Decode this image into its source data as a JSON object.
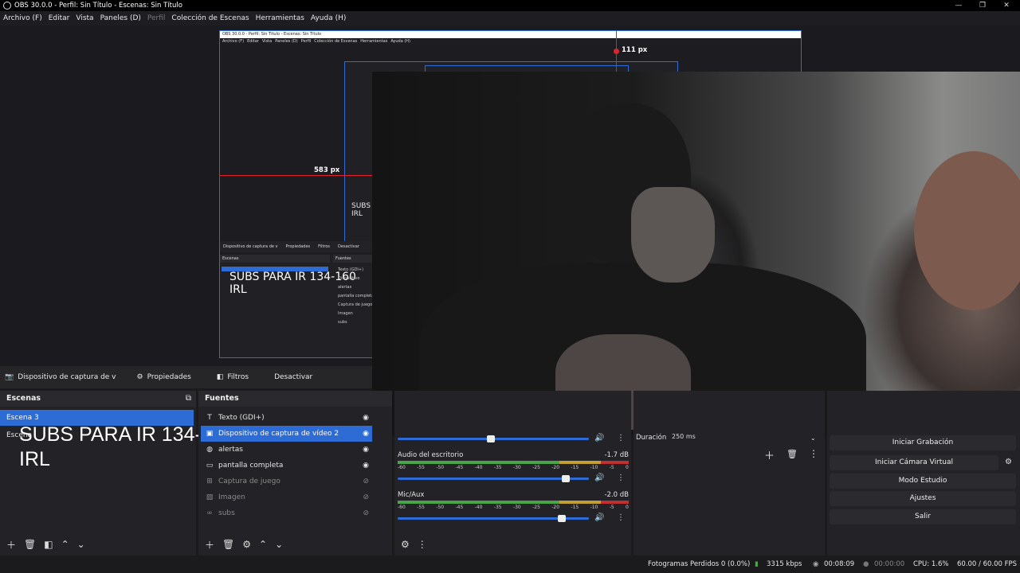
{
  "window": {
    "title": "OBS 30.0.0 - Perfil: Sin Título - Escenas: Sin Título",
    "controls": [
      "minimize",
      "maximize",
      "close"
    ]
  },
  "menu": {
    "items": [
      "Archivo (F)",
      "Editar",
      "Vista",
      "Paneles (D)",
      "Perfil",
      "Colección de Escenas",
      "Herramientas",
      "Ayuda (H)"
    ]
  },
  "preview": {
    "nested_title": "OBS 30.0.0 - Perfil: Sin Título - Escenas: Sin Título",
    "nested_menu": [
      "Archivo (F)",
      "Editar",
      "Vista",
      "Paneles (D)",
      "Perfil",
      "Colección de Escenas",
      "Herramientas",
      "Ayuda (H)"
    ],
    "label_111": "111 px",
    "label_583": "583 px",
    "nested_sourcebar": [
      "Dispositivo de captura de v",
      "Propiedades",
      "Filtros",
      "Desactivar"
    ],
    "nested_scenes_header": "Escenas",
    "nested_sources_header": "Fuentes",
    "nested_scene_sel": "Escena 3",
    "nested_subs": "SUBS PARA IR 134-160\nIRL",
    "nested_subs_small": "SUBS I\nIRL",
    "nested_sources": [
      "Texto (GDI+)",
      "Dispositivo",
      "alertas",
      "pantalla completa",
      "Captura de juego",
      "Imagen",
      "subs"
    ]
  },
  "sourcebar": {
    "source_name": "Dispositivo de captura de v",
    "properties": "Propiedades",
    "filters": "Filtros",
    "deactivate": "Desactivar"
  },
  "scenes": {
    "header": "Escenas",
    "items": [
      "Escena 3",
      "Escena"
    ],
    "selected": "Escena 3"
  },
  "subs_overlay": {
    "line1": "SUBS PARA IR 134-160",
    "line2": "IRL"
  },
  "sources": {
    "header": "Fuentes",
    "items": [
      {
        "name": "Texto (GDI+)",
        "icon": "text-icon",
        "visible": true
      },
      {
        "name": "Dispositivo de captura de vídeo 2",
        "icon": "camera-icon",
        "visible": true
      },
      {
        "name": "alertas",
        "icon": "globe-icon",
        "visible": true
      },
      {
        "name": "pantalla completa",
        "icon": "monitor-icon",
        "visible": true
      },
      {
        "name": "Captura de juego",
        "icon": "gamepad-icon",
        "visible": false
      },
      {
        "name": "Imagen",
        "icon": "image-icon",
        "visible": false
      },
      {
        "name": "subs",
        "icon": "link-icon",
        "visible": false
      }
    ]
  },
  "mixer": {
    "channels": [
      {
        "name": "Audio del escritorio",
        "db": "-1.7 dB",
        "volume": 0.9
      },
      {
        "name": "Mic/Aux",
        "db": "-2.0 dB",
        "volume": 0.88
      }
    ],
    "ticks": [
      "-60",
      "-55",
      "-50",
      "-45",
      "-40",
      "-35",
      "-30",
      "-25",
      "-20",
      "-15",
      "-10",
      "-5",
      "0"
    ]
  },
  "transitions": {
    "duration_label": "Duración",
    "duration_value": "250 ms"
  },
  "controls": {
    "start_recording": "Iniciar Grabación",
    "start_virtual_cam": "Iniciar Cámara Virtual",
    "studio_mode": "Modo Estudio",
    "settings": "Ajustes",
    "exit": "Salir"
  },
  "status": {
    "dropped_frames": "Fotogramas Perdidos 0 (0.0%)",
    "bitrate": "3315 kbps",
    "stream_time": "00:08:09",
    "rec_time": "00:00:00",
    "cpu": "CPU: 1.6%",
    "fps": "60.00 / 60.00 FPS"
  },
  "colors": {
    "accent": "#2d6bd5",
    "guide": "#e0212e"
  }
}
